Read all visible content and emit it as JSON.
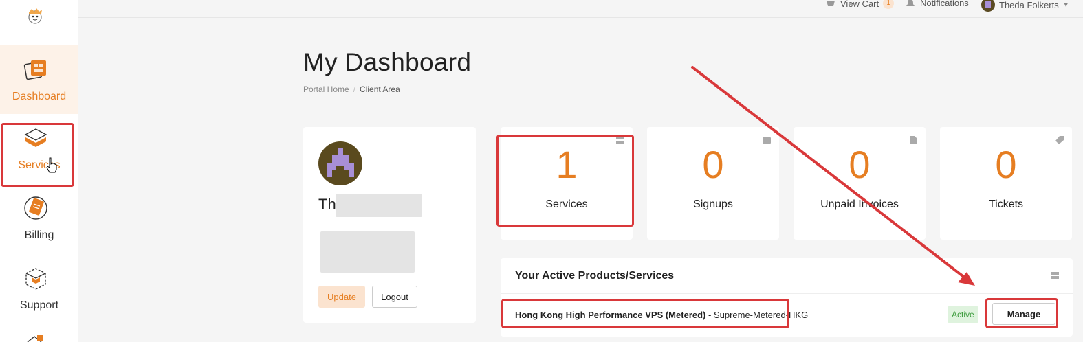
{
  "sidebar": {
    "items": [
      {
        "label": "Dashboard",
        "icon": "dashboard-icon",
        "active": true
      },
      {
        "label": "Services",
        "icon": "services-icon",
        "active": false
      },
      {
        "label": "Billing",
        "icon": "billing-icon",
        "active": false
      },
      {
        "label": "Support",
        "icon": "support-icon",
        "active": false
      }
    ]
  },
  "topbar": {
    "view_cart": "View Cart",
    "cart_count": "1",
    "notifications": "Notifications",
    "user_name": "Theda Folkerts"
  },
  "page": {
    "title": "My Dashboard",
    "breadcrumb": [
      "Portal Home",
      "Client Area"
    ]
  },
  "profile": {
    "name_prefix": "Th",
    "update_label": "Update",
    "logout_label": "Logout"
  },
  "stats": [
    {
      "value": "1",
      "label": "Services",
      "icon": "server-icon"
    },
    {
      "value": "0",
      "label": "Signups",
      "icon": "wallet-icon"
    },
    {
      "value": "0",
      "label": "Unpaid Invoices",
      "icon": "document-icon"
    },
    {
      "value": "0",
      "label": "Tickets",
      "icon": "tag-icon"
    }
  ],
  "products": {
    "title": "Your Active Products/Services",
    "rows": [
      {
        "name": "Hong Kong High Performance VPS (Metered)",
        "separator": " - ",
        "plan": "Supreme-Metered-HKG",
        "status": "Active",
        "action": "Manage"
      }
    ]
  },
  "colors": {
    "accent": "#e67e22",
    "annotation": "#d9383a",
    "active_status": "#3c9b3c"
  }
}
